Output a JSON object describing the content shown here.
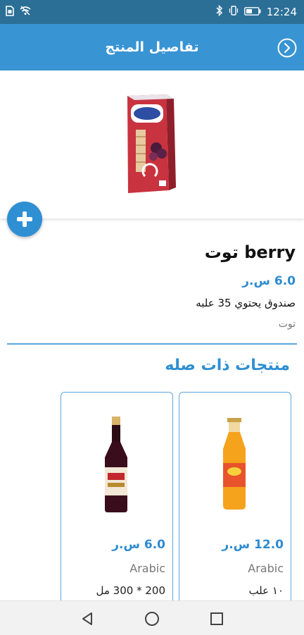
{
  "status_bar": {
    "time": "12:24",
    "icons": [
      "sim-icon",
      "wifi-off-icon",
      "bluetooth-icon",
      "vibrate-icon",
      "battery-icon"
    ]
  },
  "app_bar": {
    "title": "تفاصيل المنتج",
    "back_icon": "chevron-right-circle-icon"
  },
  "product": {
    "image_name": "berry-juice-box",
    "name": "berry توت",
    "price": "6.0 س.ر",
    "description": "صندوق يحتوي 35 علبه",
    "category": "توت"
  },
  "add_button_icon": "plus-icon",
  "related": {
    "title": "منتجات ذات صله",
    "items": [
      {
        "image_name": "orange-juice-bottle",
        "price": "12.0 س.ر",
        "category": "Arabic",
        "size": "١٠ علب"
      },
      {
        "image_name": "vimto-syrup-bottle",
        "price": "6.0 س.ر",
        "category": "Arabic",
        "size": "200 * 300 مل"
      }
    ]
  },
  "nav_bar": {
    "icons": [
      "back-triangle-icon",
      "home-circle-icon",
      "recents-square-icon"
    ]
  },
  "colors": {
    "primary": "#3894d3",
    "status_bar": "#2b6f97",
    "accent": "#2d8bd0",
    "divider": "#5aa7dd"
  }
}
